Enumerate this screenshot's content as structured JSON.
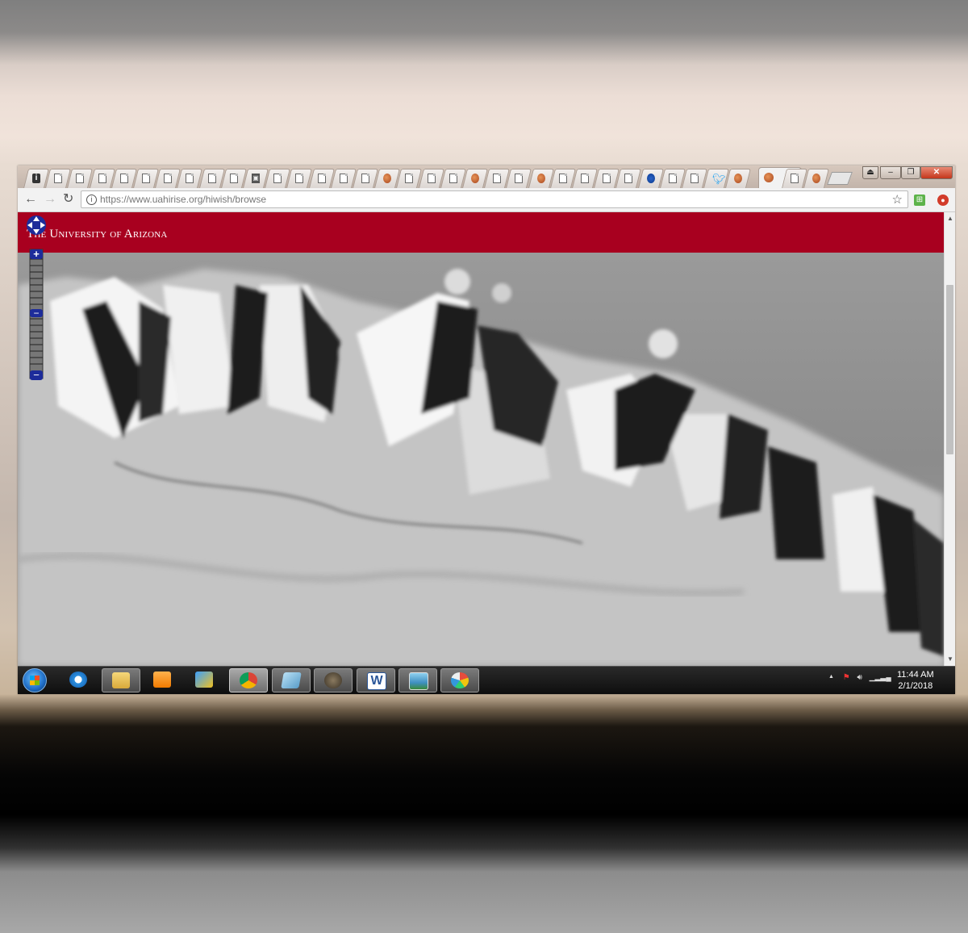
{
  "browser": {
    "tab_icons": [
      "info-icon",
      "page-icon",
      "page-icon",
      "page-icon",
      "page-icon",
      "page-icon",
      "page-icon",
      "page-icon",
      "page-icon",
      "page-icon",
      "cmd-icon",
      "page-icon",
      "page-icon",
      "page-icon",
      "page-icon",
      "page-icon",
      "mars-icon",
      "page-icon",
      "page-icon",
      "page-icon",
      "mars-icon",
      "page-icon",
      "page-icon",
      "mars-icon",
      "page-icon",
      "page-icon",
      "page-icon",
      "page-icon",
      "nasa-icon",
      "page-icon",
      "page-icon",
      "twitter-icon",
      "mars-icon"
    ],
    "active_tab_close": "×",
    "after_active_icons": [
      "page-icon",
      "mars-icon"
    ],
    "url_host": "https://www.uahirise.org",
    "url_path": "/hiwish/browse",
    "info_glyph": "i",
    "star_glyph": "☆"
  },
  "page": {
    "brand_text": "The University of Arizona",
    "banner_color": "#a8001f"
  },
  "map": {
    "zoom_plus": "+",
    "zoom_minus": "−",
    "zoom_mid": "−"
  },
  "taskbar": {
    "apps": [
      "internet-explorer-icon",
      "file-explorer-icon",
      "media-player-icon",
      "program-icon",
      "chrome-icon",
      "notes-icon",
      "gimp-icon",
      "word-icon",
      "photo-viewer-icon",
      "paint-icon"
    ],
    "active_app": "chrome-icon",
    "word_letter": "W",
    "time": "11:44 AM",
    "date": "2/1/2018",
    "tray_arrow": "▲"
  }
}
